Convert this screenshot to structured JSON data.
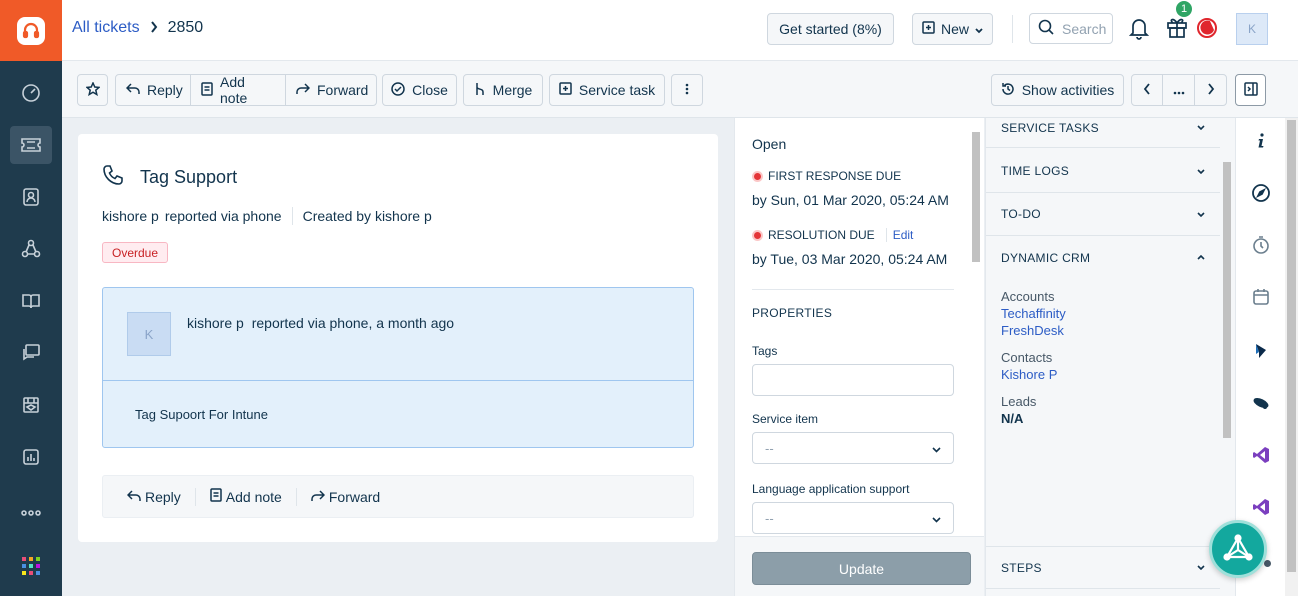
{
  "header": {
    "breadcrumb_link": "All tickets",
    "breadcrumb_current": "2850",
    "get_started": "Get started (8%)",
    "new_label": "New",
    "search_placeholder": "Search",
    "gift_badge": "1",
    "avatar_initial": "K"
  },
  "toolbar": {
    "reply": "Reply",
    "add_note": "Add note",
    "forward": "Forward",
    "close": "Close",
    "merge": "Merge",
    "service_task": "Service task",
    "show_activities": "Show activities"
  },
  "ticket": {
    "subject": "Tag Support",
    "reporter": "kishore p",
    "reported_via": "reported via phone",
    "created_by": "Created by kishore p",
    "badge": "Overdue",
    "conversation": {
      "avatar_initial": "K",
      "author": "kishore p",
      "summary": "reported via phone, a month ago",
      "body": "Tag Supoort For Intune"
    },
    "actions": {
      "reply": "Reply",
      "add_note": "Add note",
      "forward": "Forward"
    }
  },
  "properties": {
    "status": "Open",
    "first_response_label": "FIRST RESPONSE DUE",
    "first_response_date": "by Sun, 01 Mar 2020, 05:24 AM",
    "resolution_label": "RESOLUTION DUE",
    "resolution_edit": "Edit",
    "resolution_date": "by Tue, 03 Mar 2020, 05:24 AM",
    "section_title": "PROPERTIES",
    "tags_label": "Tags",
    "tags_value": "",
    "service_item_label": "Service item",
    "service_item_value": "--",
    "language_label": "Language application support",
    "language_value": "--",
    "update_button": "Update"
  },
  "sidebar_panels": {
    "service_tasks": "SERVICE TASKS",
    "time_logs": "TIME LOGS",
    "todo": "TO-DO",
    "dynamic_crm": "DYNAMIC CRM",
    "steps": "STEPS",
    "crm": {
      "accounts_label": "Accounts",
      "accounts": [
        "Techaffinity",
        "FreshDesk"
      ],
      "contacts_label": "Contacts",
      "contacts": [
        "Kishore P"
      ],
      "leads_label": "Leads",
      "leads_value": "N/A"
    }
  },
  "colors": {
    "brand": "#f05a28",
    "nav_bg": "#1f3b4d",
    "link": "#2c5cc5",
    "overdue": "#c82124",
    "fab": "#13a89e"
  }
}
